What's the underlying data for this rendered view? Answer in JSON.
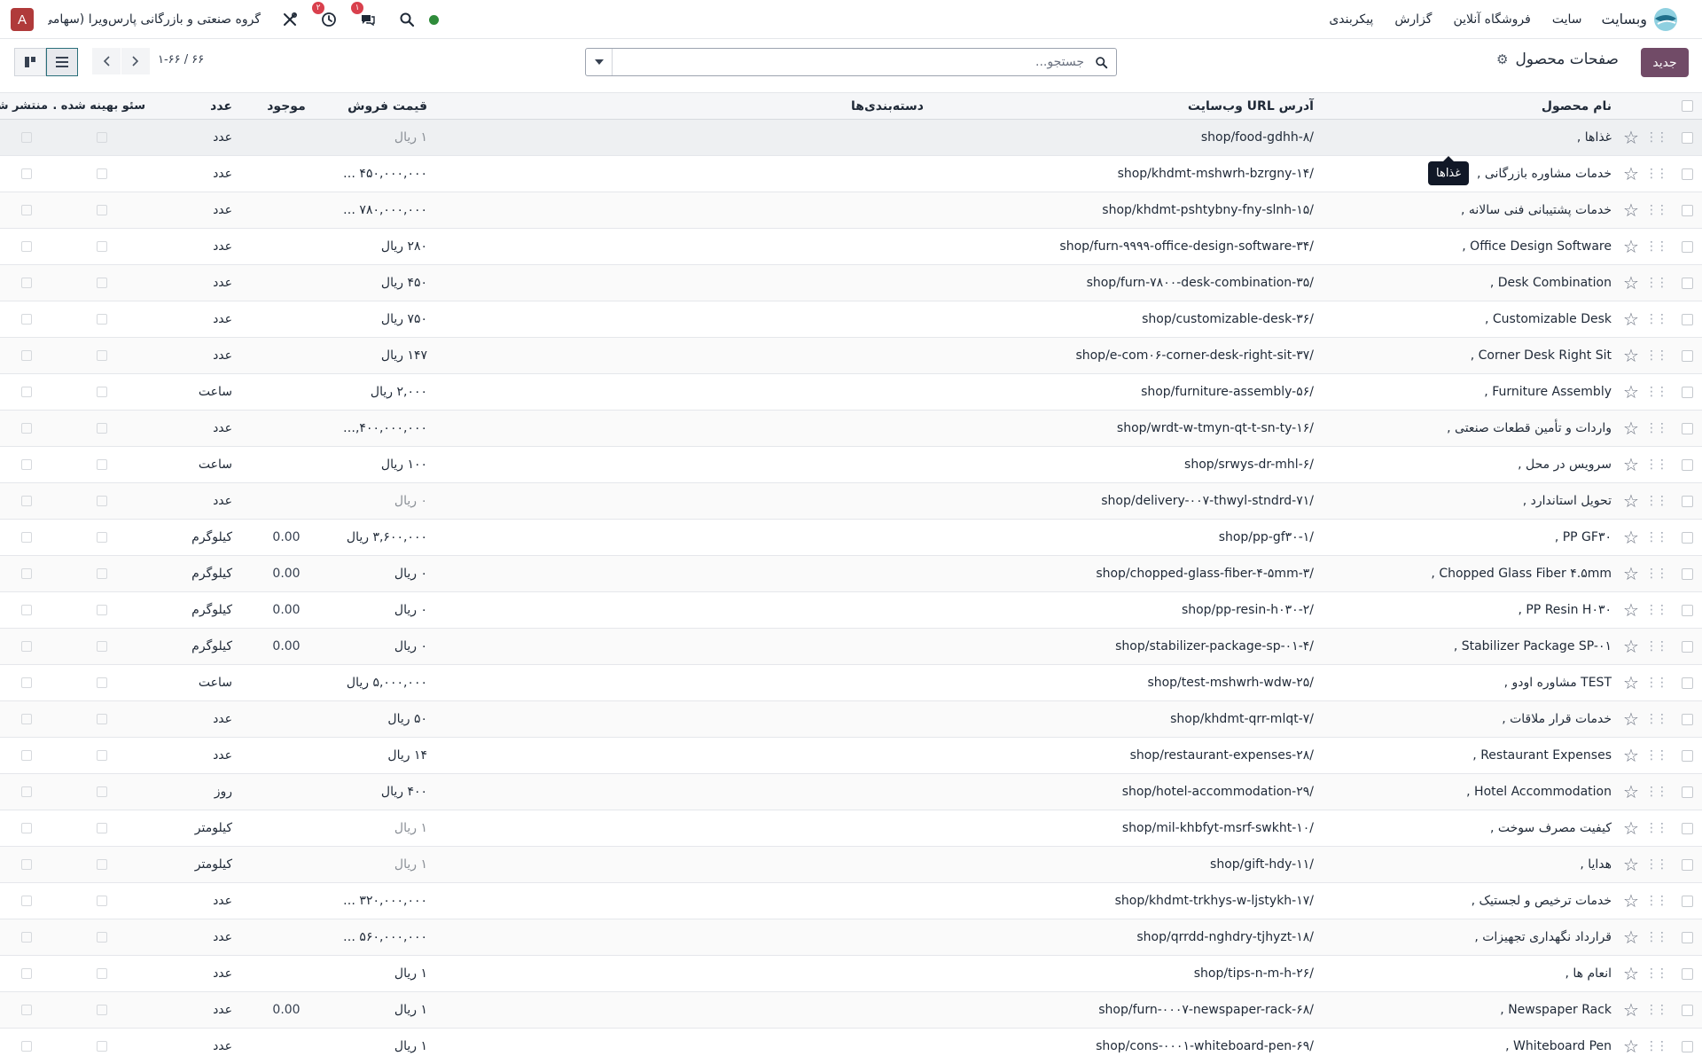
{
  "navbar": {
    "brand": "وبسایت",
    "menu": [
      "سایت",
      "فروشگاه آنلاین",
      "گزارش",
      "پیکربندی"
    ],
    "company": "گروه صنعتی و بازرگانی پارس‌ویرا (سهامی ...",
    "avatar_letter": "A",
    "activity_badge": "۲",
    "chat_badge": "۱",
    "icons": [
      "tools-icon",
      "clock-icon",
      "chat-icon",
      "search-icon",
      "status-dot"
    ]
  },
  "control": {
    "new_label": "جدید",
    "title": "صفحات محصول",
    "search_placeholder": "جستجو...",
    "pager": "۱-۶۶ / ۶۶"
  },
  "columns": {
    "name": "نام محصول",
    "url": "آدرس URL وب‌سایت",
    "categories": "دسته‌بندی‌ها",
    "price": "قیمت فروش",
    "qty": "موجود",
    "uom": "عدد",
    "seo": "سئو بهینه شده ...",
    "published": "منتشر شده است"
  },
  "tooltip": "غذاها",
  "rows": [
    {
      "name": "غذاها ,",
      "url": "/shop/food-gdhh-۸",
      "price": "۱ ریال",
      "price_muted": true,
      "qty": "",
      "uom": "عدد"
    },
    {
      "name": "خدمات مشاوره بازرگانی ,",
      "url": "/shop/khdmt-mshwrh-bzrgny-۱۴",
      "price": "۴۵۰,۰۰۰,۰۰۰ ریال",
      "price_muted": false,
      "qty": "",
      "uom": "عدد"
    },
    {
      "name": "خدمات پشتیبانی فنی سالانه ,",
      "url": "/shop/khdmt-pshtybny-fny-slnh-۱۵",
      "price": "۷۸۰,۰۰۰,۰۰۰ ریال",
      "price_muted": false,
      "qty": "",
      "uom": "عدد"
    },
    {
      "name": "Office Design Software ,",
      "url": "/shop/furn-۹۹۹۹-office-design-software-۳۴",
      "price": "۲۸۰ ریال",
      "price_muted": false,
      "qty": "",
      "uom": "عدد"
    },
    {
      "name": "Desk Combination ,",
      "url": "/shop/furn-۷۸۰۰-desk-combination-۳۵",
      "price": "۴۵۰ ریال",
      "price_muted": false,
      "qty": "",
      "uom": "عدد"
    },
    {
      "name": "Customizable Desk ,",
      "url": "/shop/customizable-desk-۳۶",
      "price": "۷۵۰ ریال",
      "price_muted": false,
      "qty": "",
      "uom": "عدد"
    },
    {
      "name": "Corner Desk Right Sit ,",
      "url": "/shop/e-com۰۶-corner-desk-right-sit-۳۷",
      "price": "۱۴۷ ریال",
      "price_muted": false,
      "qty": "",
      "uom": "عدد"
    },
    {
      "name": "Furniture Assembly ,",
      "url": "/shop/furniture-assembly-۵۶",
      "price": "۲,۰۰۰ ریال",
      "price_muted": false,
      "qty": "",
      "uom": "ساعت"
    },
    {
      "name": "واردات و تأمین قطعات صنعتی ,",
      "url": "/shop/wrdt-w-tmyn-qt-t-sn-ty-۱۶",
      "price": "۲,۴۰۰,۰۰۰,۰۰۰ ...",
      "price_muted": false,
      "qty": "",
      "uom": "عدد"
    },
    {
      "name": "سرویس در محل ,",
      "url": "/shop/srwys-dr-mhl-۶",
      "price": "۱۰۰ ریال",
      "price_muted": false,
      "qty": "",
      "uom": "ساعت"
    },
    {
      "name": "تحویل استاندارد ,",
      "url": "/shop/delivery-۰۰۷-thwyl-stndrd-۷۱",
      "price": "۰ ریال",
      "price_muted": true,
      "qty": "",
      "uom": "عدد"
    },
    {
      "name": "PP GF۳۰ ,",
      "url": "/shop/pp-gf۳۰-۱",
      "price": "۳,۶۰۰,۰۰۰ ریال",
      "price_muted": false,
      "qty": "0.00",
      "uom": "کیلوگرم"
    },
    {
      "name": "Chopped Glass Fiber ۴.۵mm ,",
      "url": "/shop/chopped-glass-fiber-۴-۵mm-۳",
      "price": "۰ ریال",
      "price_muted": false,
      "qty": "0.00",
      "uom": "کیلوگرم"
    },
    {
      "name": "PP Resin H۰۳۰ ,",
      "url": "/shop/pp-resin-h۰۳۰-۲",
      "price": "۰ ریال",
      "price_muted": false,
      "qty": "0.00",
      "uom": "کیلوگرم"
    },
    {
      "name": "Stabilizer Package SP-۰۱ ,",
      "url": "/shop/stabilizer-package-sp-۰۱-۴",
      "price": "۰ ریال",
      "price_muted": false,
      "qty": "0.00",
      "uom": "کیلوگرم"
    },
    {
      "name": "TEST مشاوره اودو ,",
      "url": "/shop/test-mshwrh-wdw-۲۵",
      "price": "۵,۰۰۰,۰۰۰ ریال",
      "price_muted": false,
      "qty": "",
      "uom": "ساعت"
    },
    {
      "name": "خدمات قرار ملاقات ,",
      "url": "/shop/khdmt-qrr-mlqt-۷",
      "price": "۵۰ ریال",
      "price_muted": false,
      "qty": "",
      "uom": "عدد"
    },
    {
      "name": "Restaurant Expenses ,",
      "url": "/shop/restaurant-expenses-۲۸",
      "price": "۱۴ ریال",
      "price_muted": false,
      "qty": "",
      "uom": "عدد"
    },
    {
      "name": "Hotel Accommodation ,",
      "url": "/shop/hotel-accommodation-۲۹",
      "price": "۴۰۰ ریال",
      "price_muted": false,
      "qty": "",
      "uom": "روز"
    },
    {
      "name": "کیفیت مصرف سوخت ,",
      "url": "/shop/mil-khbfyt-msrf-swkht-۱۰",
      "price": "۱ ریال",
      "price_muted": true,
      "qty": "",
      "uom": "کیلومتر"
    },
    {
      "name": "هدایا ,",
      "url": "/shop/gift-hdy-۱۱",
      "price": "۱ ریال",
      "price_muted": true,
      "qty": "",
      "uom": "کیلومتر"
    },
    {
      "name": "خدمات ترخیص و لجستیک ,",
      "url": "/shop/khdmt-trkhys-w-ljstykh-۱۷",
      "price": "۳۲۰,۰۰۰,۰۰۰ ریال",
      "price_muted": false,
      "qty": "",
      "uom": "عدد"
    },
    {
      "name": "قرارداد نگهداری تجهیزات ,",
      "url": "/shop/qrrdd-nghdry-tjhyzt-۱۸",
      "price": "۵۶۰,۰۰۰,۰۰۰ ریال",
      "price_muted": false,
      "qty": "",
      "uom": "عدد"
    },
    {
      "name": "انعام ها ,",
      "url": "/shop/tips-n-m-h-۲۶",
      "price": "۱ ریال",
      "price_muted": false,
      "qty": "",
      "uom": "عدد"
    },
    {
      "name": "Newspaper Rack ,",
      "url": "/shop/furn-۰۰۰۷-newspaper-rack-۶۸",
      "price": "۱ ریال",
      "price_muted": false,
      "qty": "0.00",
      "uom": "عدد"
    },
    {
      "name": "Whiteboard Pen ,",
      "url": "/shop/cons-۰۰۰۱-whiteboard-pen-۶۹",
      "price": "۱ ریال",
      "price_muted": false,
      "qty": "",
      "uom": "عدد"
    }
  ],
  "colors": {
    "primary": "#714b67",
    "avatar": "#b03a3a",
    "status": "#2e8b3a",
    "badge": "#d9404d"
  }
}
